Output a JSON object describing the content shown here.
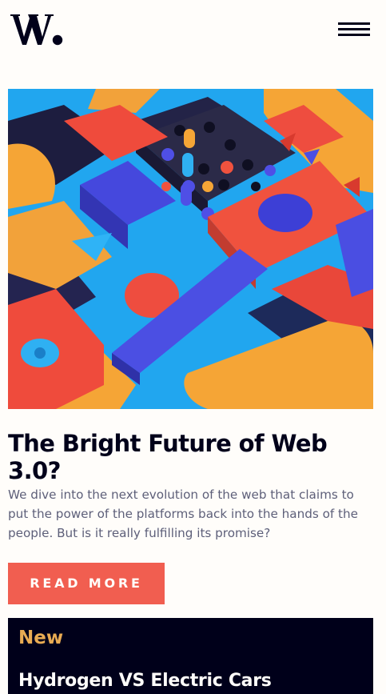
{
  "header": {
    "logo_alt": "W.",
    "menu_icon": "hamburger-menu-icon"
  },
  "hero": {
    "image_icon": "abstract-3d-blocks-image"
  },
  "article": {
    "title": "The Bright Future of Web 3.0?",
    "description": "We dive into the next evolution of the web that claims to put the power of the platforms back into the hands of the people. But is it really fulfilling its promise?",
    "cta_label": "READ MORE"
  },
  "new_section": {
    "heading": "New",
    "items": [
      {
        "title": "Hydrogen VS Electric Cars"
      }
    ]
  },
  "colors": {
    "background": "#fffdfa",
    "text_dark": "#00001a",
    "text_muted": "#5d5f79",
    "accent_red": "#f15e50",
    "accent_orange": "#e9ab53"
  }
}
